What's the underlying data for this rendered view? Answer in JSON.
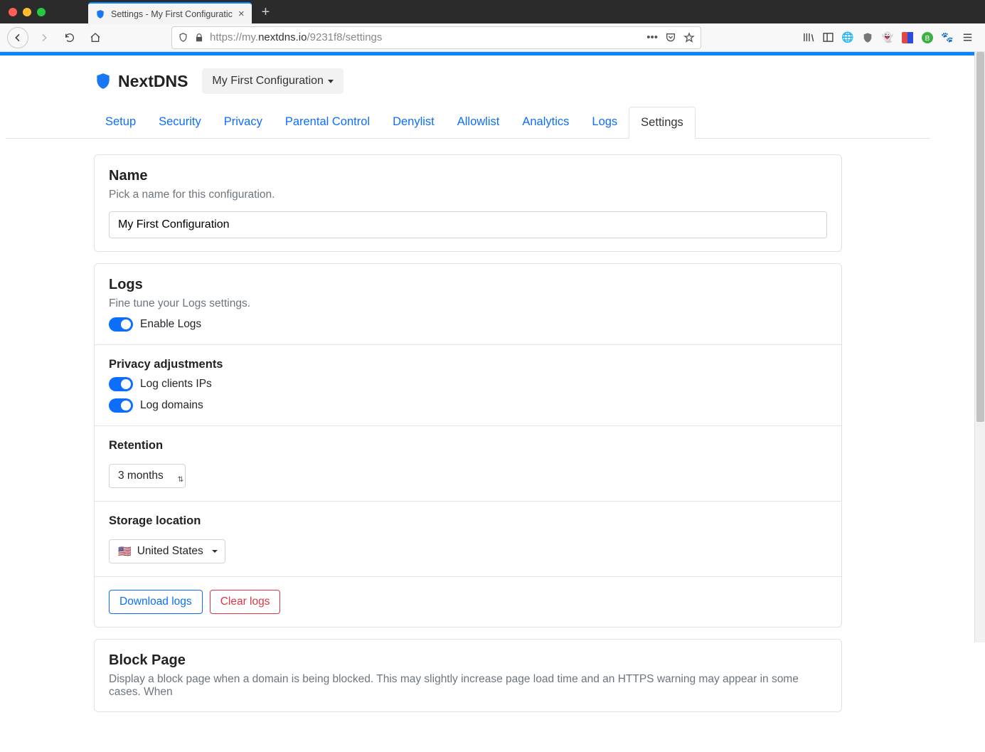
{
  "browser": {
    "tab_title": "Settings - My First Configuratic",
    "url_display_pre": "https://my.",
    "url_display_host": "nextdns.io",
    "url_display_path": "/9231f8/settings"
  },
  "header": {
    "brand": "NextDNS",
    "config_selector": "My First Configuration"
  },
  "nav": {
    "items": [
      {
        "label": "Setup"
      },
      {
        "label": "Security"
      },
      {
        "label": "Privacy"
      },
      {
        "label": "Parental Control"
      },
      {
        "label": "Denylist"
      },
      {
        "label": "Allowlist"
      },
      {
        "label": "Analytics"
      },
      {
        "label": "Logs"
      },
      {
        "label": "Settings"
      }
    ],
    "active_index": 8
  },
  "name_card": {
    "title": "Name",
    "desc": "Pick a name for this configuration.",
    "value": "My First Configuration"
  },
  "logs_card": {
    "title": "Logs",
    "desc": "Fine tune your Logs settings.",
    "enable_label": "Enable Logs",
    "privacy_title": "Privacy adjustments",
    "log_ips_label": "Log clients IPs",
    "log_domains_label": "Log domains",
    "retention_title": "Retention",
    "retention_value": "3 months",
    "storage_title": "Storage location",
    "storage_flag": "🇺🇸",
    "storage_value": "United States",
    "download_label": "Download logs",
    "clear_label": "Clear logs"
  },
  "block_card": {
    "title": "Block Page",
    "desc": "Display a block page when a domain is being blocked. This may slightly increase page load time and an HTTPS warning may appear in some cases. When"
  }
}
